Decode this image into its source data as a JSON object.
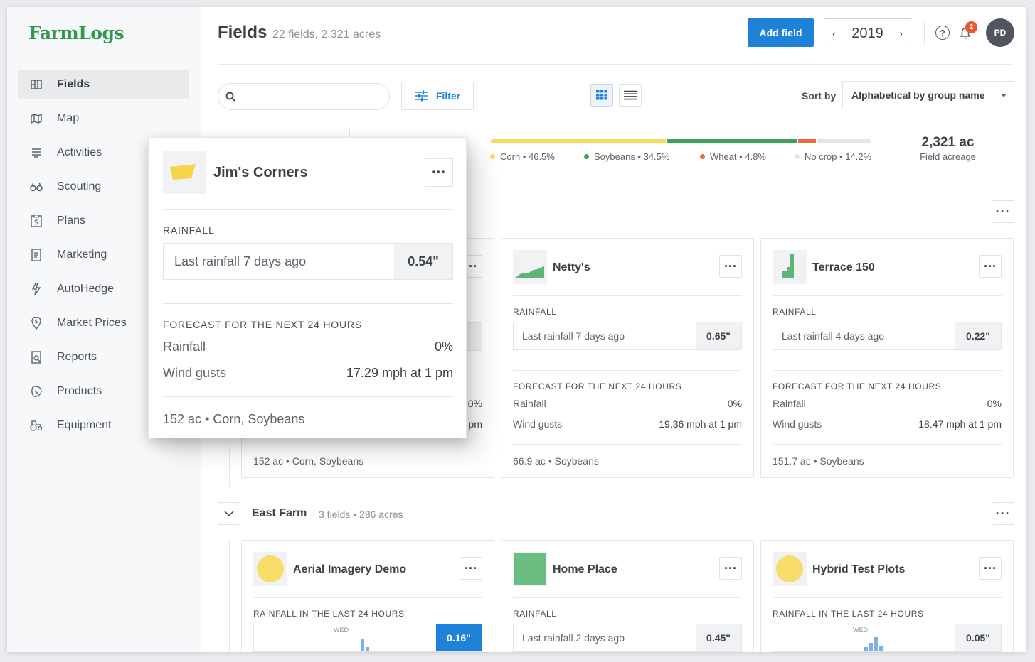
{
  "app": {
    "logo": "FarmLogs"
  },
  "sidebar": {
    "items": [
      {
        "label": "Fields",
        "icon": "fields-icon",
        "active": true
      },
      {
        "label": "Map",
        "icon": "map-icon"
      },
      {
        "label": "Activities",
        "icon": "activities-icon"
      },
      {
        "label": "Scouting",
        "icon": "binoculars-icon"
      },
      {
        "label": "Plans",
        "icon": "plans-icon"
      },
      {
        "label": "Marketing",
        "icon": "marketing-icon"
      },
      {
        "label": "AutoHedge",
        "icon": "autohedge-icon"
      },
      {
        "label": "Market Prices",
        "icon": "market-prices-icon"
      },
      {
        "label": "Reports",
        "icon": "reports-icon"
      },
      {
        "label": "Products",
        "icon": "products-icon"
      },
      {
        "label": "Equipment",
        "icon": "equipment-icon"
      }
    ]
  },
  "header": {
    "title": "Fields",
    "subtitle": "22 fields, 2,321 acres",
    "add_label": "Add field",
    "year": "2019",
    "notifications": "2",
    "avatar": "PD"
  },
  "toolbar": {
    "search_placeholder": "",
    "filter_label": "Filter",
    "sort_label": "Sort by",
    "sort_value": "Alphabetical by group name"
  },
  "crops": {
    "segments": [
      {
        "label": "Corn • 46.5%",
        "pct": 46.5,
        "color": "#f5dc5a"
      },
      {
        "label": "Soybeans • 34.5%",
        "pct": 34.5,
        "color": "#3ea35a"
      },
      {
        "label": "Wheat • 4.8%",
        "pct": 4.8,
        "color": "#ee6a3a"
      },
      {
        "label": "No crop • 14.2%",
        "pct": 14.2,
        "color": "#e3e5e8"
      }
    ],
    "total": "2,321 ac",
    "total_label": "Field acreage"
  },
  "popup": {
    "name": "Jim's Corners",
    "rain_section": "RAINFALL",
    "last_rain": "Last rainfall 7 days ago",
    "last_rain_value": "0.54\"",
    "forecast_section": "FORECAST FOR THE NEXT 24 HOURS",
    "rain_label": "Rainfall",
    "rain_value": "0%",
    "wind_label": "Wind gusts",
    "wind_value": "17.29 mph at 1 pm",
    "footer": "152 ac • Corn, Soybeans"
  },
  "group1": {
    "behind_card": {
      "footer": "152 ac • Corn, Soybeans",
      "rain_partial": "\"",
      "forecast_partial": "0%",
      "wind_partial": "pm"
    },
    "cards": [
      {
        "name": "Netty's",
        "rain_section": "RAINFALL",
        "last_rain": "Last rainfall 7 days ago",
        "last_rain_value": "0.65\"",
        "forecast_section": "FORECAST FOR THE NEXT 24 HOURS",
        "rain_label": "Rainfall",
        "rain_value": "0%",
        "wind_label": "Wind gusts",
        "wind_value": "19.36 mph at 1 pm",
        "footer": "66.9 ac • Soybeans"
      },
      {
        "name": "Terrace 150",
        "rain_section": "RAINFALL",
        "last_rain": "Last rainfall 4 days ago",
        "last_rain_value": "0.22\"",
        "forecast_section": "FORECAST FOR THE NEXT 24 HOURS",
        "rain_label": "Rainfall",
        "rain_value": "0%",
        "wind_label": "Wind gusts",
        "wind_value": "18.47 mph at 1 pm",
        "footer": "151.7 ac • Soybeans"
      }
    ]
  },
  "group2": {
    "name": "East Farm",
    "sub": "3 fields • 286 acres",
    "cards": [
      {
        "name": "Aerial Imagery Demo",
        "section": "RAINFALL IN THE LAST 24 HOURS",
        "day": "WED",
        "value": "0.16\""
      },
      {
        "name": "Home Place",
        "section": "RAINFALL",
        "last_rain": "Last rainfall 2 days ago",
        "value": "0.45\""
      },
      {
        "name": "Hybrid Test Plots",
        "section": "RAINFALL IN THE LAST 24 HOURS",
        "day": "WED",
        "value": "0.05\""
      }
    ]
  }
}
